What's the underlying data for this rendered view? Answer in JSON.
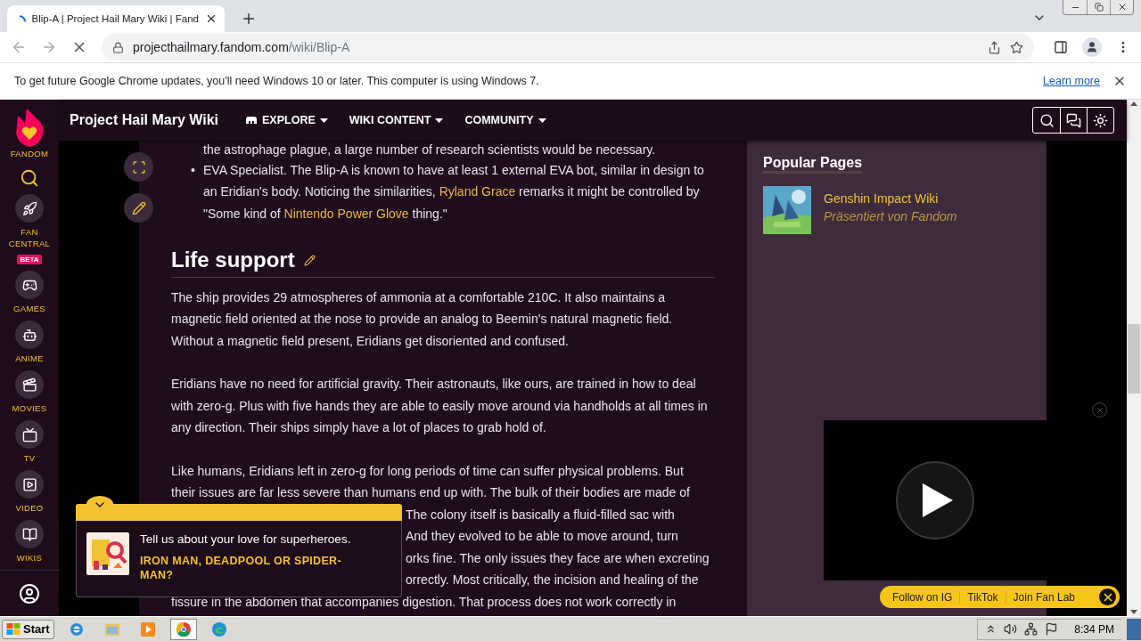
{
  "browser": {
    "tab": {
      "title": "Blip-A | Project Hail Mary Wiki | Fand",
      "loading": true
    },
    "url": {
      "host": "projecthailmary.fandom.com",
      "path": "/wiki/Blip-A"
    },
    "infobar": {
      "message": "To get future Google Chrome updates, you'll need Windows 10 or later. This computer is using Windows 7.",
      "link": "Learn more"
    }
  },
  "global_nav": {
    "logo_label": "FANDOM",
    "items": [
      {
        "kind": "rocket",
        "label": "FAN CENTRAL",
        "badge": "BETA"
      },
      {
        "kind": "games",
        "label": "GAMES"
      },
      {
        "kind": "anime",
        "label": "ANIME"
      },
      {
        "kind": "movies",
        "label": "MOVIES"
      },
      {
        "kind": "tv",
        "label": "TV"
      },
      {
        "kind": "video",
        "label": "VIDEO"
      },
      {
        "kind": "wikis",
        "label": "WIKIS"
      }
    ]
  },
  "wiki_header": {
    "title": "Project Hail Mary Wiki",
    "menus": [
      {
        "kind": "explore",
        "label": "EXPLORE"
      },
      {
        "kind": "plain",
        "label": "WIKI CONTENT"
      },
      {
        "kind": "plain",
        "label": "COMMUNITY"
      }
    ]
  },
  "article": {
    "bullets": [
      {
        "parts": [
          {
            "kind": "text",
            "text": "the astrophage plague, a large number of research scientists would be necessary."
          }
        ]
      },
      {
        "marker": "•",
        "parts": [
          {
            "kind": "text",
            "text": "EVA Specialist. The Blip-A is known to have at least 1 external EVA bot, similar in design to an Eridian's body. Noticing the similarities, "
          },
          {
            "kind": "link",
            "text": "Ryland Grace"
          },
          {
            "kind": "text",
            "text": " remarks it might be controlled by \"Some kind of "
          },
          {
            "kind": "link",
            "text": "Nintendo Power Glove"
          },
          {
            "kind": "text",
            "text": " thing.\""
          }
        ]
      }
    ],
    "heading": "Life support",
    "paragraphs": [
      "The ship provides 29 atmospheres of ammonia at a comfortable 210C. It also maintains a magnetic field oriented at the nose to provide an analog to Beemin's natural magnetic field. Without a magnetic field present, Eridians get disoriented and confused.",
      "Eridians have no need for artificial gravity. Their astronauts, like ours, are trained in how to deal with zero-g. Plus with five hands they are able to easily move around via handholds at all times in any direction. Their ships simply have a lot of places to grab hold of."
    ],
    "last_paragraph_lines": [
      {
        "kind": "full",
        "text": "Like humans, Eridians left in zero-g for long periods of time can suffer physical problems. But"
      },
      {
        "kind": "full",
        "text": "their issues are far less severe than humans end up with. The bulk of their bodies are made of"
      },
      {
        "kind": "cut",
        "text": "The colony itself is basically a fluid-filled sac with"
      },
      {
        "kind": "cut",
        "text": "And they evolved to be able to move around, turn"
      },
      {
        "kind": "cut",
        "text": "orks fine. The only issues they face are when excreting"
      },
      {
        "kind": "cut",
        "text": "orrectly. Most critically, the incision and healing of the"
      },
      {
        "kind": "full",
        "text": "fissure in the abdomen that accompanies digestion. That process does not work correctly in"
      }
    ]
  },
  "popular_pages": {
    "title": "Popular Pages",
    "items": [
      {
        "title": "Genshin Impact Wiki",
        "subtitle": "Präsentiert von Fandom"
      }
    ]
  },
  "survey_popup": {
    "question": "Tell us about your love for superheroes.",
    "answer": "IRON MAN, DEADPOOL OR SPIDER-MAN?"
  },
  "video_bar": {
    "links": [
      "Follow on IG",
      "TikTok",
      "Join Fan Lab"
    ]
  },
  "taskbar": {
    "start": "Start",
    "clock": "8:34 PM",
    "apps": [
      {
        "kind": "ie",
        "selected": false
      },
      {
        "kind": "folder",
        "selected": false
      },
      {
        "kind": "media",
        "selected": false
      },
      {
        "kind": "chrome",
        "selected": true
      },
      {
        "kind": "edge",
        "selected": false
      }
    ]
  }
}
